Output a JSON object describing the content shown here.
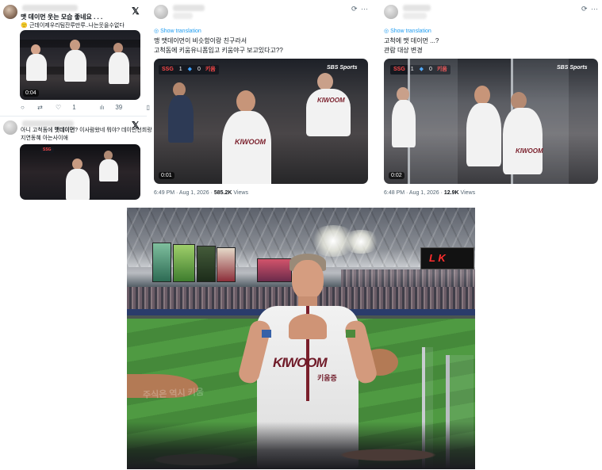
{
  "tweet1": {
    "line1": "맷 데이먼 웃는 모습 좋네요 . . .",
    "line2": "근데이제우리팀잔루만루..나는웃을수없다",
    "video_time": "0:04",
    "reply_count": "",
    "retweet_count": "",
    "like_count": "1",
    "view_count": "39"
  },
  "tweet2": {
    "line1_part1": "아니 고척돔에 ",
    "line1_bold": "맷데이먼",
    "line1_part2": "? 이사람왔네 뭐야? 데이먼선희랑",
    "line2": "지연동혜 아는사이애"
  },
  "tweet3": {
    "show_translation": "Show translation",
    "line1": "맹 맷데이먼이 비슷함이랑 친구라서",
    "line2": "고척돔에 키움유니폼입고 키움야구 보고있다고??",
    "score_team1": "SSG",
    "score_num1": "1",
    "score_num2": "0",
    "score_team2": "키움",
    "broadcaster": "SBS Sports",
    "video_time": "0:01",
    "timestamp": "6:49 PM · Aug 1, 2026 · ",
    "views_count": "585.2K",
    "views_label": " Views"
  },
  "tweet4": {
    "show_translation": "Show translation",
    "line1": "고척에 맷 데이먼 ...?",
    "line2": "관람 대상 변경",
    "score_team1": "SSG",
    "score_num1": "1",
    "score_num2": "0",
    "score_team2": "키움",
    "broadcaster": "SBS Sports",
    "video_time": "0:02",
    "timestamp": "6:48 PM · Aug 1, 2026 · ",
    "views_count": "12.9K",
    "views_label": " Views"
  },
  "photo": {
    "jersey_logo": "KIWOOM",
    "jersey_sub": "키움증",
    "scoreboard": "L K",
    "field_lettering": "주식은 역시 키움"
  },
  "icons": {
    "x_logo": "𝕏",
    "reply": "○",
    "retweet": "⇄",
    "like": "♡",
    "views": "📊",
    "bookmark": "▯",
    "share": "⇧",
    "refresh": "⟳",
    "more": "···"
  }
}
